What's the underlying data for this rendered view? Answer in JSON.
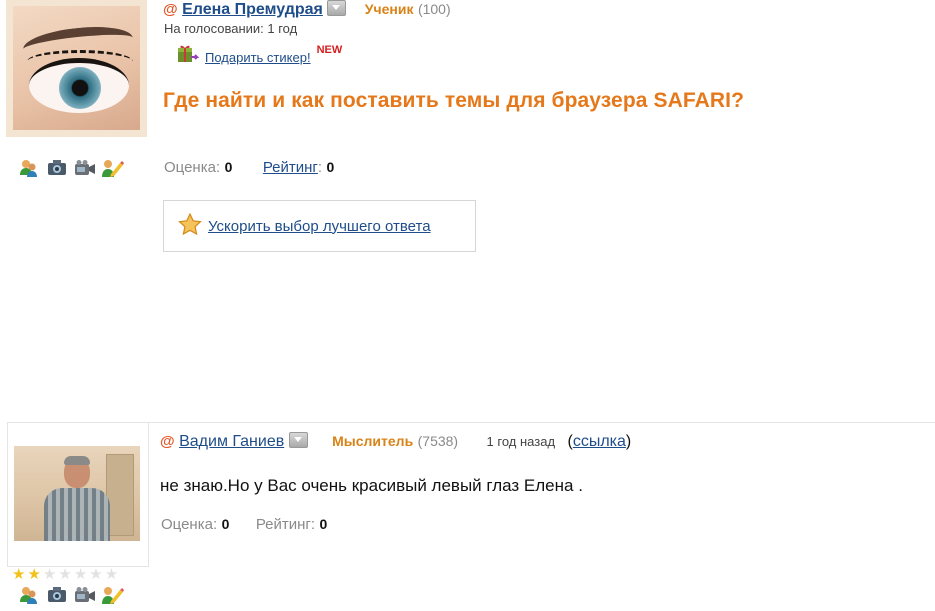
{
  "question": {
    "author": {
      "at_symbol": "@",
      "name": "Елена Премудрая",
      "rank_title": "Ученик",
      "rank_points": "(100)"
    },
    "voting_status": "На голосовании: 1 год",
    "gift_link": "Подарить стикер!",
    "new_badge": "NEW",
    "title": "Где найти и как поставить темы для браузера SAFARI?",
    "score_label": "Оценка",
    "score_value": "0",
    "rating_label": "Рейтинг",
    "rating_value": "0",
    "speedup_label": "Ускорить выбор лучшего ответа",
    "icons": [
      "friends-icon",
      "camera-icon",
      "video-icon",
      "edit-icon"
    ]
  },
  "answer": {
    "author": {
      "at_symbol": "@",
      "name": "Вадим Ганиев",
      "rank_title": "Мыслитель",
      "rank_points": "(7538)"
    },
    "time": "1 год назад",
    "link_open": "(",
    "link_text": "ссылка",
    "link_close": ")",
    "text": "не знаю.Но у Вас очень красивый левый глаз Елена .",
    "score_label": "Оценка",
    "score_value": "0",
    "rating_label": "Рейтинг",
    "rating_value": "0",
    "stars_filled": 2,
    "stars_total": 7,
    "icons": [
      "friends-icon",
      "camera-icon",
      "video-icon",
      "edit-icon"
    ]
  },
  "colors": {
    "link": "#1f4d8a",
    "title": "#e5781a",
    "rank": "#d88318",
    "at": "#e05a2a"
  }
}
